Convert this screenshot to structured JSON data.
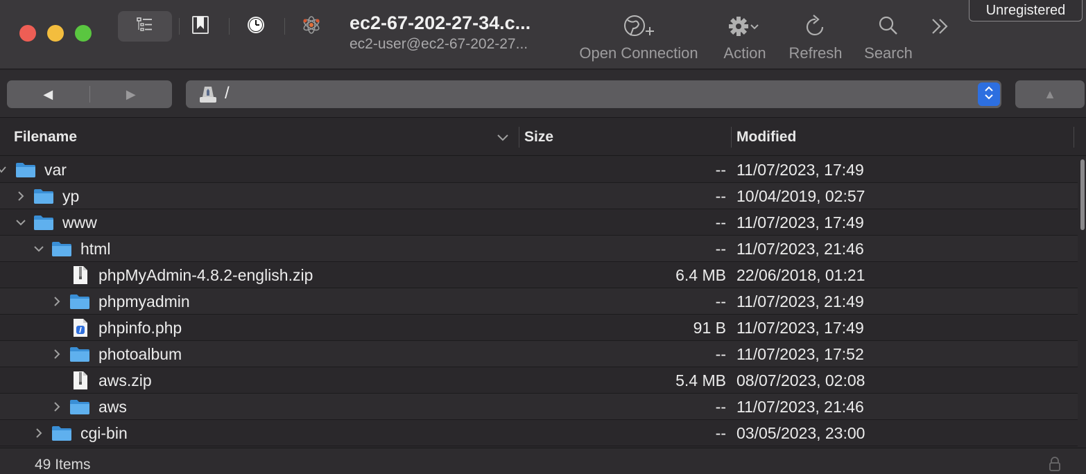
{
  "window": {
    "connection_title": "ec2-67-202-27-34.c...",
    "connection_subtitle": "ec2-user@ec2-67-202-27...",
    "badge": "Unregistered"
  },
  "toolbar": {
    "open_connection": "Open Connection",
    "action": "Action",
    "refresh": "Refresh",
    "search": "Search"
  },
  "pathbar": {
    "back": "◀",
    "forward": "▶",
    "path": "/",
    "up": "▲"
  },
  "columns": {
    "filename": "Filename",
    "size": "Size",
    "modified": "Modified"
  },
  "files": [
    {
      "name": "var",
      "type": "folder",
      "depth": 0,
      "expanded": true,
      "size": "--",
      "modified": "11/07/2023, 17:49"
    },
    {
      "name": "yp",
      "type": "folder",
      "depth": 1,
      "expanded": false,
      "size": "--",
      "modified": "10/04/2019, 02:57"
    },
    {
      "name": "www",
      "type": "folder",
      "depth": 1,
      "expanded": true,
      "size": "--",
      "modified": "11/07/2023, 17:49"
    },
    {
      "name": "html",
      "type": "folder",
      "depth": 2,
      "expanded": true,
      "size": "--",
      "modified": "11/07/2023, 21:46"
    },
    {
      "name": "phpMyAdmin-4.8.2-english.zip",
      "type": "zip",
      "depth": 3,
      "size": "6.4 MB",
      "modified": "22/06/2018, 01:21"
    },
    {
      "name": "phpmyadmin",
      "type": "folder",
      "depth": 3,
      "expanded": false,
      "size": "--",
      "modified": "11/07/2023, 21:49"
    },
    {
      "name": "phpinfo.php",
      "type": "php",
      "depth": 3,
      "size": "91 B",
      "modified": "11/07/2023, 17:49"
    },
    {
      "name": "photoalbum",
      "type": "folder",
      "depth": 3,
      "expanded": false,
      "size": "--",
      "modified": "11/07/2023, 17:52"
    },
    {
      "name": "aws.zip",
      "type": "zip",
      "depth": 3,
      "size": "5.4 MB",
      "modified": "08/07/2023, 02:08"
    },
    {
      "name": "aws",
      "type": "folder",
      "depth": 3,
      "expanded": false,
      "size": "--",
      "modified": "11/07/2023, 21:46"
    },
    {
      "name": "cgi-bin",
      "type": "folder",
      "depth": 2,
      "expanded": false,
      "size": "--",
      "modified": "03/05/2023, 23:00"
    }
  ],
  "status": {
    "item_count": "49 Items"
  }
}
